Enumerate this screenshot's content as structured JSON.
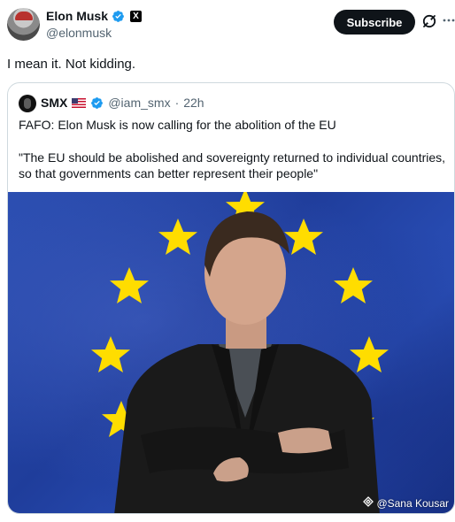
{
  "author": {
    "name": "Elon Musk",
    "handle": "@elonmusk",
    "affiliate_badge": "X"
  },
  "actions": {
    "subscribe_label": "Subscribe",
    "grok_icon": "grok-icon",
    "more_icon": "more-dots-icon"
  },
  "tweet": {
    "text": "I mean it. Not kidding."
  },
  "quote": {
    "name": "SMX",
    "handle": "@iam_smx",
    "separator": "·",
    "time": "22h",
    "line1": "FAFO: Elon Musk is now calling for the abolition of the EU",
    "line2": "\"The EU should be abolished and sovereignty returned to individual countries, so that governments can better represent their people\"",
    "media": {
      "watermark": "@Sana Kousar",
      "watermark_icon": "binance-diamond-icon"
    }
  },
  "colors": {
    "verified_blue": "#1d9bf0",
    "text_primary": "#0f1419",
    "text_secondary": "#536471",
    "eu_blue": "#2448a8",
    "eu_star_yellow": "#ffdd00"
  }
}
